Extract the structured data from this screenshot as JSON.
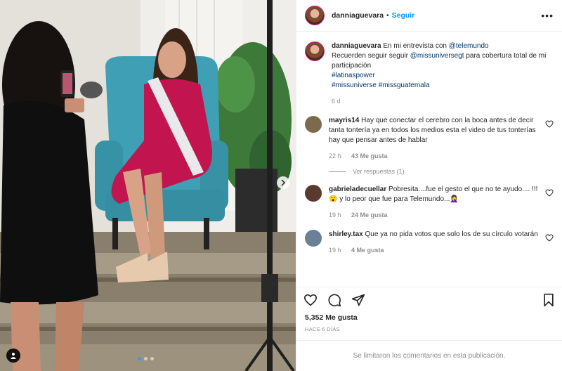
{
  "post": {
    "username": "danniaguevara",
    "separator": "•",
    "follow_label": "Seguir",
    "more_label": "•••"
  },
  "caption": {
    "username": "danniaguevara",
    "text_1": "En mi entrevista con ",
    "mention_1": "@telemundo",
    "text_2": "Recuerden seguir seguir ",
    "mention_2": "@missuniversegt",
    "text_3": " para cobertura total de mi participación",
    "hashtag_1": "#latinaspower",
    "hashtag_2": "#missuniverse",
    "hashtag_3": "#missguatemala",
    "time": "6 d"
  },
  "comments": [
    {
      "username": "mayris14",
      "text": "Hay que conectar el cerebro con la boca antes de decir tanta tontería ya en todos los medios esta el video de tus tonterías hay que pensar antes de hablar",
      "time": "22 h",
      "likes": "43 Me gusta",
      "replies": "Ver respuestas (1)"
    },
    {
      "username": "gabrieladecuellar",
      "text": "Pobresita....fue el gesto el que no te ayudo.... !!! 😮 y lo peor que fue para Telemundo...🤦‍♀️",
      "time": "19 h",
      "likes": "24 Me gusta"
    },
    {
      "username": "shirley.tax",
      "text": "Que ya no pida votos que solo los de su círculo votarán",
      "time": "19 h",
      "likes": "4 Me gusta"
    }
  ],
  "stats": {
    "likes": "5,352 Me gusta",
    "posted": "HACE 6 DÍAS"
  },
  "footer": {
    "limited": "Se limitaron los comentarios en esta publicación."
  },
  "carousel": {
    "active_index": 0,
    "count": 3
  },
  "colors": {
    "accent": "#0095f6",
    "link": "#00376b",
    "muted": "#8e8e8e",
    "dress": "#c2154f",
    "chair": "#3f9fb4"
  }
}
